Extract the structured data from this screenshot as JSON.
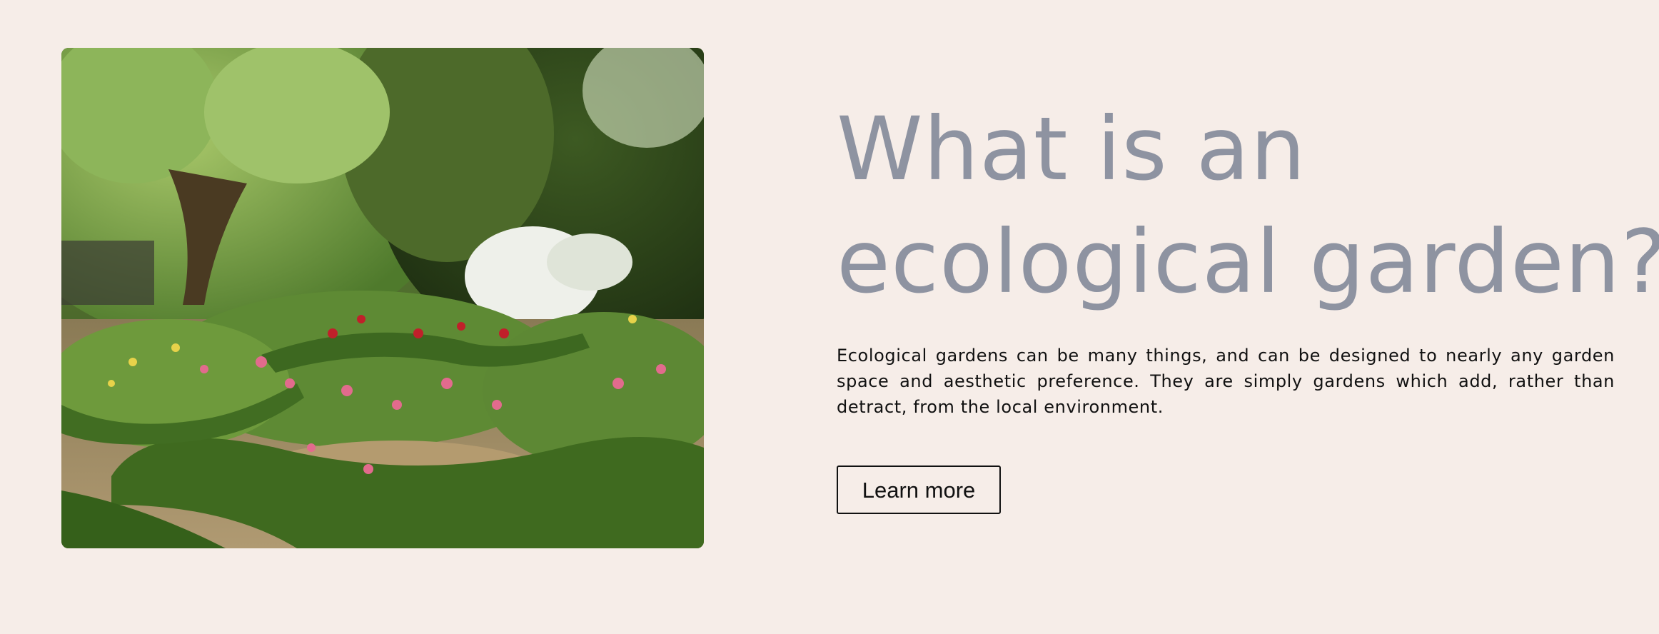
{
  "hero": {
    "image": {
      "alt": "Formal rose garden bordered by curving boxwood hedges under large trees"
    },
    "headline_line1": "What is an",
    "headline_line2": "ecological garden?",
    "description": "Ecological gardens can be many things, and can be designed to nearly any garden space and aesthetic preference. They are simply gardens which add, rather than detract, from the local environment.",
    "cta_label": "Learn more"
  },
  "colors": {
    "background": "#f6ede8",
    "headline": "#8e93a1",
    "text": "#111111",
    "button_border": "#111111"
  }
}
